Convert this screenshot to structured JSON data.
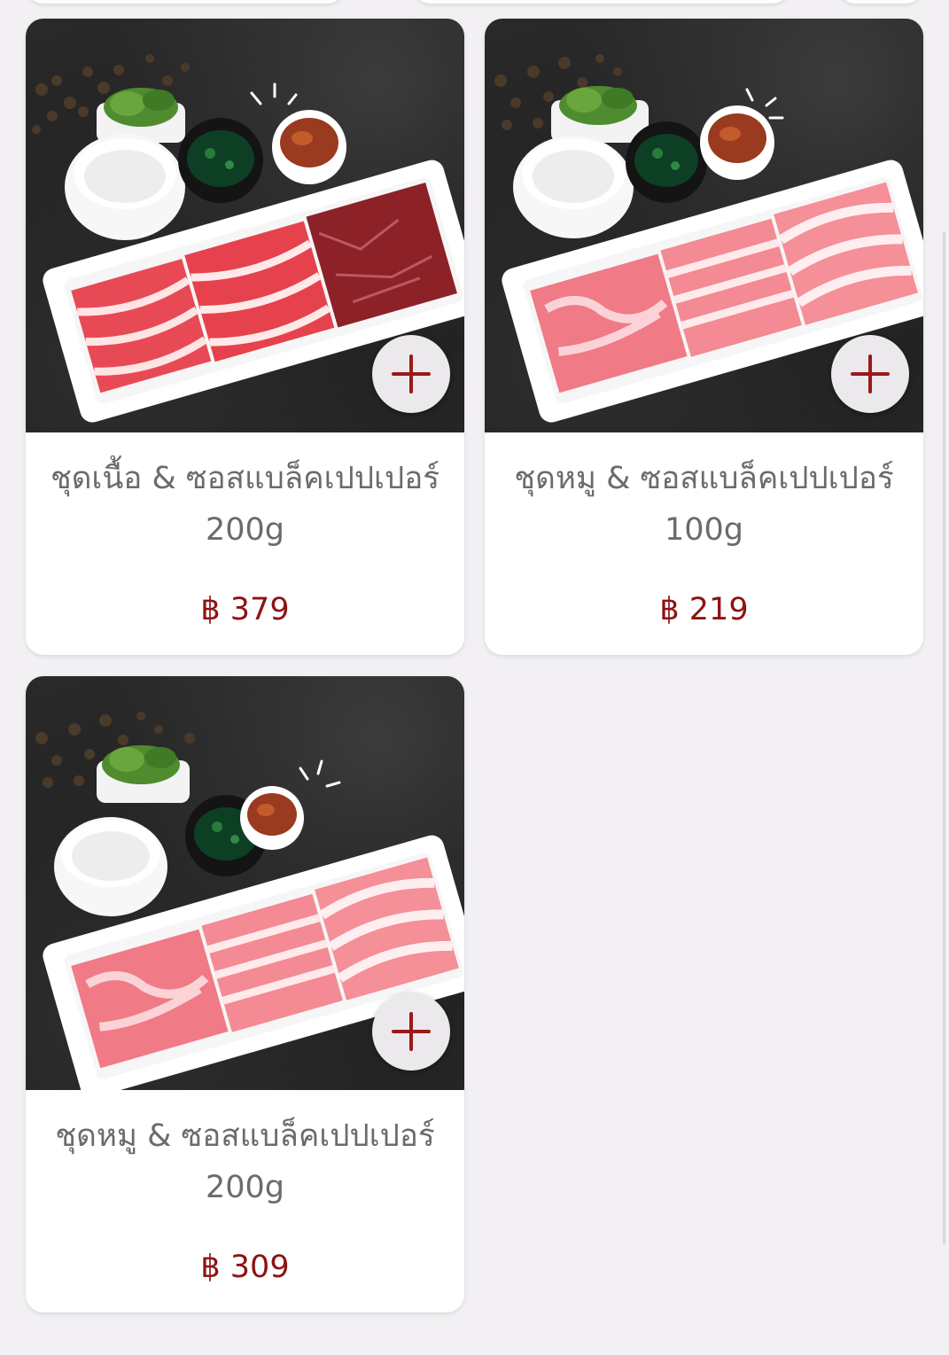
{
  "currency_symbol": "฿",
  "colors": {
    "background": "#f2f0f3",
    "card": "#ffffff",
    "price": "#8e1313",
    "add_icon": "#9a1a1a",
    "title": "#6b6b6b"
  },
  "products": [
    {
      "name": "ชุดเนื้อ & ซอสแบล็คเปปเปอร์ 200g",
      "price_text": "฿ 379",
      "meat": "beef",
      "add_icon": "plus-icon"
    },
    {
      "name": "ชุดหมู & ซอสแบล็คเปปเปอร์ 100g",
      "price_text": "฿ 219",
      "meat": "pork",
      "add_icon": "plus-icon"
    },
    {
      "name": "ชุดหมู & ซอสแบล็คเปปเปอร์ 200g",
      "price_text": "฿ 309",
      "meat": "pork",
      "add_icon": "plus-icon"
    }
  ]
}
